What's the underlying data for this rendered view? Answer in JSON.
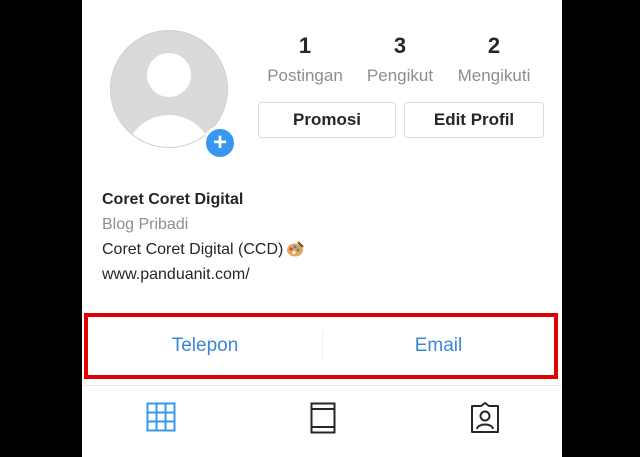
{
  "profile": {
    "stats": [
      {
        "value": "1",
        "label": "Postingan"
      },
      {
        "value": "3",
        "label": "Pengikut"
      },
      {
        "value": "2",
        "label": "Mengikuti"
      }
    ],
    "buttons": {
      "promote": "Promosi",
      "edit": "Edit Profil"
    },
    "add_badge": "+",
    "bio": {
      "name": "Coret Coret Digital",
      "category": "Blog Pribadi",
      "description": "Coret Coret Digital (CCD)",
      "website": "www.panduanit.com/"
    }
  },
  "contact": {
    "phone": "Telepon",
    "email": "Email"
  },
  "tabs": [
    {
      "icon": "grid-icon",
      "active": true
    },
    {
      "icon": "feed-icon",
      "active": false
    },
    {
      "icon": "tagged-icon",
      "active": false
    }
  ],
  "colors": {
    "accent": "#3897f0",
    "link": "#3a86d6",
    "highlight_border": "#e00000",
    "muted_text": "#8e8e8e",
    "background": "#000000"
  }
}
